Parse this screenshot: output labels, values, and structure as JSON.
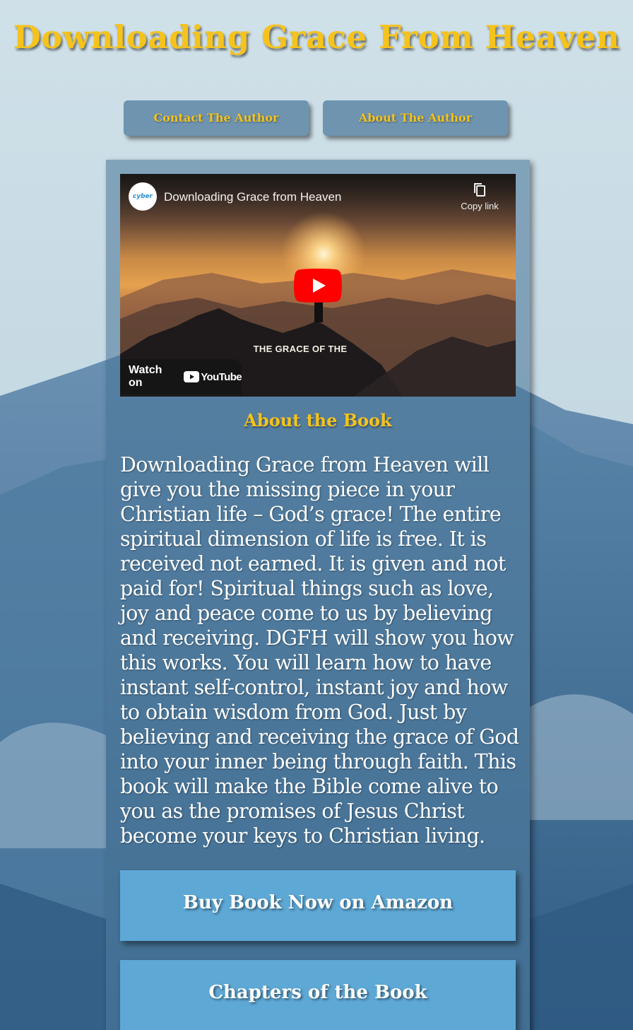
{
  "page": {
    "title": "Downloading Grace From Heaven"
  },
  "nav": {
    "contact_label": "Contact The Author",
    "about_label": "About The Author"
  },
  "video": {
    "title": "Downloading Grace from Heaven",
    "channel_logo_text": "cyber",
    "copy_link_label": "Copy link",
    "caption": "THE GRACE OF THE",
    "watch_on_label": "Watch on",
    "platform_label": "YouTube"
  },
  "book": {
    "heading": "About the Book",
    "description": "Downloading Grace from Heaven will give you the missing piece in your Christian life – God’s grace! The entire spiritual dimension of life is free. It is received not earned. It is given and not paid for! Spiritual things such as love, joy and peace come to us by believing and receiving. DGFH will show you how this works. You will learn how to have instant self-control, instant joy and how to obtain wisdom from God. Just by believing and receiving the grace of God into your inner being through faith. This book will make the Bible come alive to you as the promises of Jesus Christ become your keys to Christian living."
  },
  "actions": {
    "buy_label": "Buy Book Now on Amazon",
    "chapters_label": "Chapters of the Book"
  },
  "colors": {
    "title_gold": "#f5c31c",
    "cta_blue": "#5ea8d6",
    "nav_blue": "#6e94b0",
    "youtube_red": "#ff0000"
  },
  "icons": {
    "play": "play-icon",
    "copy": "copy-icon",
    "youtube": "youtube-logo-icon"
  }
}
